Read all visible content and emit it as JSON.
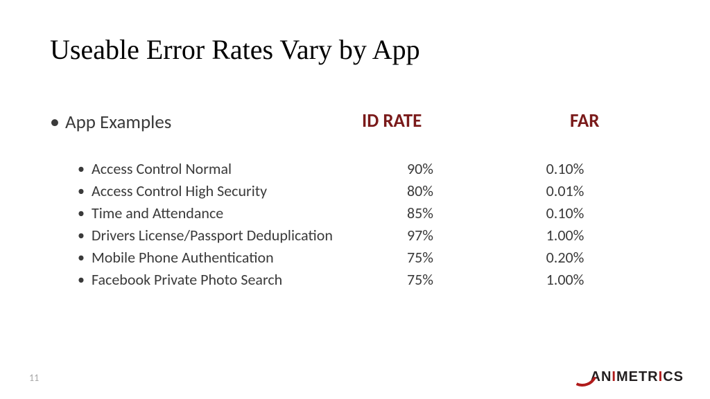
{
  "title": "Useable Error Rates Vary by App",
  "header": {
    "app_examples": "App  Examples",
    "id_rate": "ID RATE",
    "far": "FAR"
  },
  "rows": [
    {
      "label": "Access Control Normal",
      "id_rate": "90%",
      "far": "0.10%"
    },
    {
      "label": "Access Control High Security",
      "id_rate": "80%",
      "far": "0.01%"
    },
    {
      "label": "Time and Attendance",
      "id_rate": "85%",
      "far": "0.10%"
    },
    {
      "label": "Drivers License/Passport Deduplication",
      "id_rate": "97%",
      "far": "1.00%"
    },
    {
      "label": "Mobile Phone Authentication",
      "id_rate": "75%",
      "far": "0.20%"
    },
    {
      "label": "Facebook Private Photo Search",
      "id_rate": "75%",
      "far": "1.00%"
    }
  ],
  "page_number": "11",
  "logo_text": "ANIMETRICS"
}
